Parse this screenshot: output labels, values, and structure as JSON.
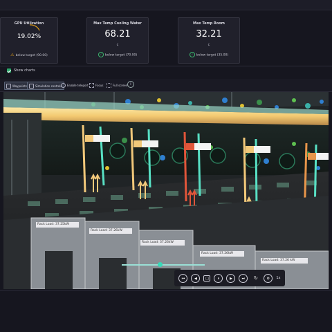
{
  "cards": [
    {
      "title": "GPU Utilization",
      "value": "19.02%",
      "target": "below target (90.00)",
      "status": "warning"
    },
    {
      "title": "Max Temp Cooling Water",
      "value": "68.21",
      "unit": "c",
      "target": "below target (70.00)",
      "status": "ok"
    },
    {
      "title": "Max Temp Room",
      "value": "32.21",
      "unit": "c",
      "target": "below target (35.00)",
      "status": "ok"
    }
  ],
  "show_charts": {
    "label": "Show charts",
    "checked": true
  },
  "toolbar": {
    "waypoints": "Waypoints",
    "simulation_controls": "Simulation controls",
    "enable_teleport": "Enable teleport",
    "focus": "Focus",
    "full_screen": "Full screen"
  },
  "racks": [
    {
      "label": "Rack Load: 37.25kW"
    },
    {
      "label": "Rack Load: 37.26kW"
    },
    {
      "label": "Rack Load: 37.26kW"
    },
    {
      "label": "Rack Load: 37.26kW"
    },
    {
      "label": "Rack Load: 37.26 kW"
    }
  ],
  "playback": {
    "speed": "1x",
    "progress": 0.45
  },
  "colors": {
    "accent": "#38d9b8",
    "ok": "#3bb86e",
    "warning": "#e6a21a",
    "pipe": "#f3d27a"
  }
}
